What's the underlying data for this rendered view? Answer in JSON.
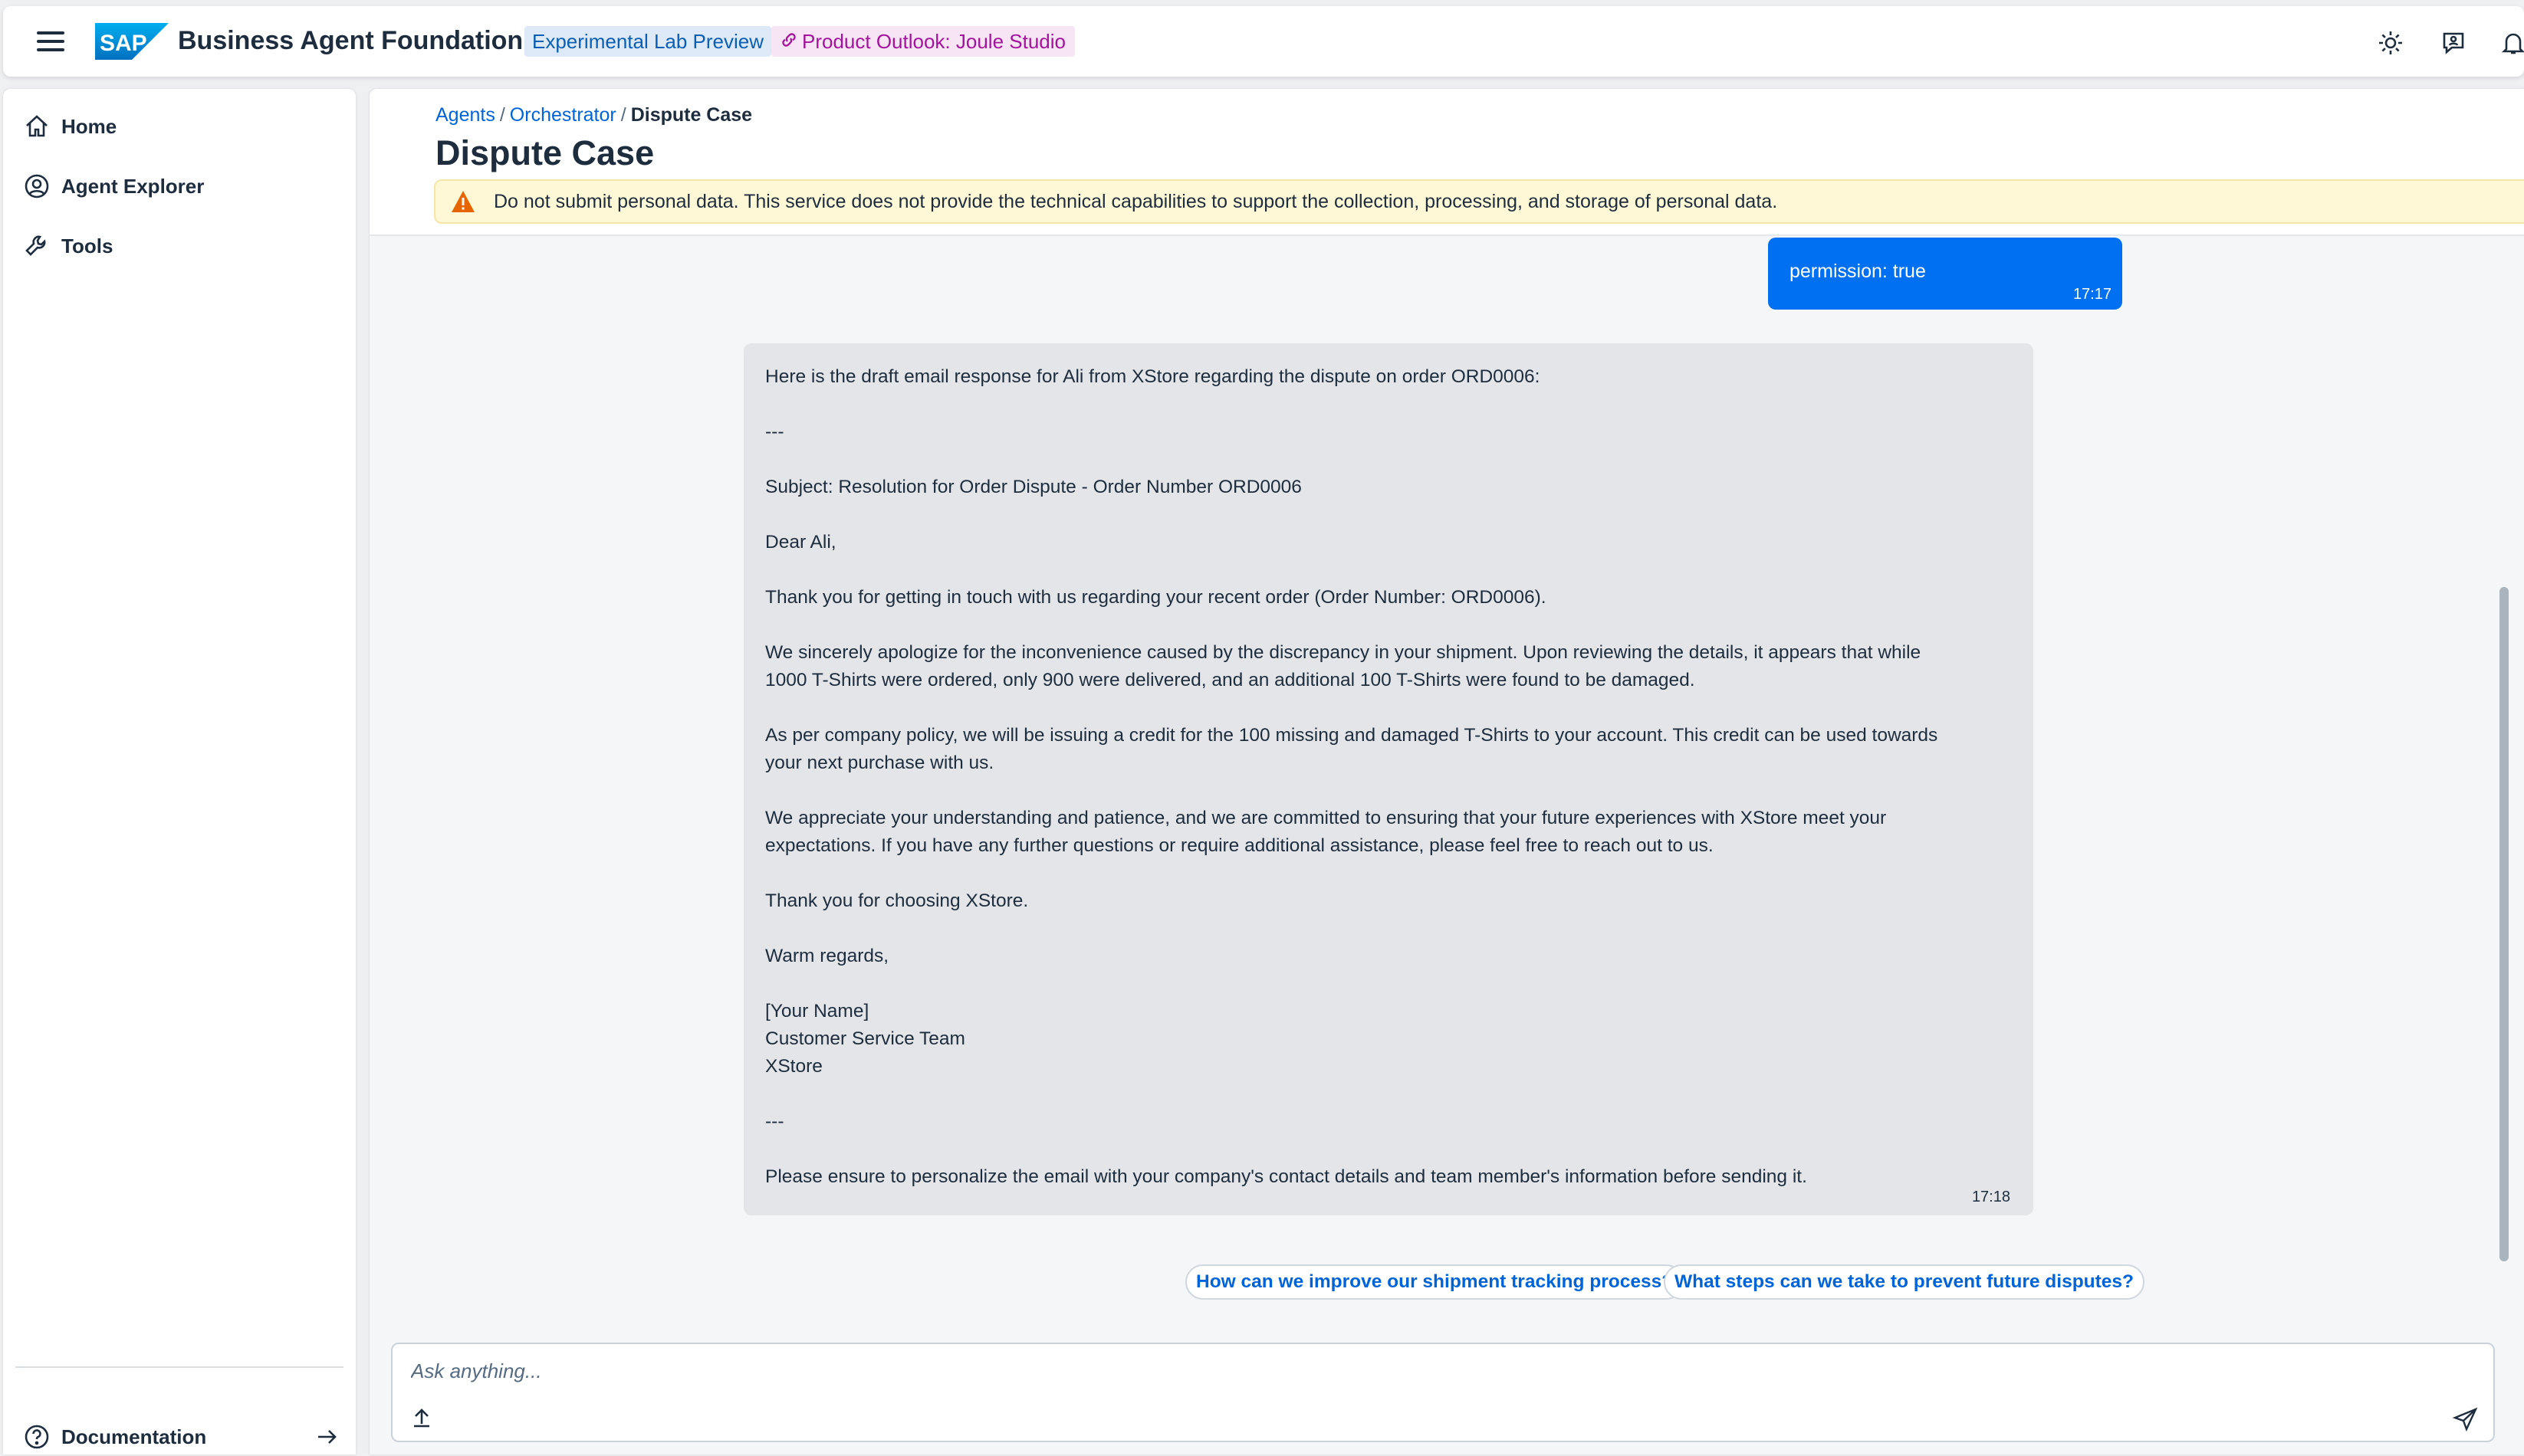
{
  "header": {
    "logo_text": "SAP",
    "app_title": "Business Agent Foundation",
    "badge_lab": "Experimental Lab Preview",
    "badge_outlook": "Product Outlook: Joule Studio",
    "icons": [
      "menu-icon",
      "sun-icon",
      "feedback-icon",
      "bell-icon"
    ]
  },
  "sidebar": {
    "items": [
      {
        "label": "Home",
        "icon": "home-icon"
      },
      {
        "label": "Agent Explorer",
        "icon": "person-icon"
      },
      {
        "label": "Tools",
        "icon": "wrench-icon"
      }
    ],
    "footer": {
      "label": "Documentation",
      "icon": "question-icon",
      "trail_icon": "arrow-right-icon"
    }
  },
  "breadcrumb": {
    "items": [
      "Agents",
      "Orchestrator"
    ],
    "separator": "/",
    "current": "Dispute Case"
  },
  "page": {
    "title": "Dispute Case",
    "warning": "Do not submit personal data. This service does not provide the technical capabilities to support the collection, processing, and storage of personal data."
  },
  "chat": {
    "user_message": {
      "text": "permission: true",
      "time": "17:17"
    },
    "agent_message": {
      "lines": [
        "Here is the draft email response for Ali from XStore regarding the dispute on order ORD0006:",
        "---",
        "Subject: Resolution for Order Dispute - Order Number ORD0006",
        "Dear Ali,",
        "Thank you for getting in touch with us regarding your recent order (Order Number: ORD0006).",
        "We sincerely apologize for the inconvenience caused by the discrepancy in your shipment. Upon reviewing the details, it appears that while",
        "1000 T-Shirts were ordered, only 900 were delivered, and an additional 100 T-Shirts were found to be damaged.",
        "As per company policy, we will be issuing a credit for the 100 missing and damaged T-Shirts to your account. This credit can be used towards",
        "your next purchase with us.",
        "We appreciate your understanding and patience, and we are committed to ensuring that your future experiences with XStore meet your",
        "expectations. If you have any further questions or require additional assistance, please feel free to reach out to us.",
        "Thank you for choosing XStore.",
        "Warm regards,",
        "[Your Name]",
        "Customer Service Team",
        "XStore",
        "---",
        "Please ensure to personalize the email with your company's contact details and team member's information before sending it."
      ],
      "time": "17:18"
    },
    "suggestions": [
      "How can we improve our shipment tracking process?",
      "What steps can we take to prevent future disputes?"
    ]
  },
  "input": {
    "placeholder": "Ask anything...",
    "value": ""
  },
  "colors": {
    "accent": "#0070f2",
    "link": "#0064d9",
    "warning_bg": "#fff8d6",
    "warning_icon": "#e76500"
  }
}
